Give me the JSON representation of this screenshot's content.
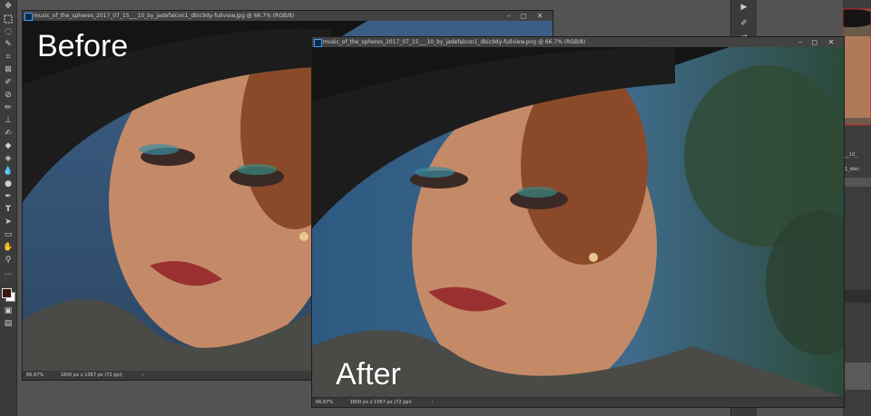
{
  "before_window": {
    "title": "music_of_the_spheres_2017_07_15___10_by_jadefalcon1_dbic9dy-fullview.jpg @ 66.7% (RGB/8)",
    "zoom": "66.67%",
    "dimensions": "1600 px x 1067 px (72 ppi)",
    "overlay_label": "Before"
  },
  "after_window": {
    "title": "music_of_the_spheres_2017_07_15___10_by_jadefalcon1_dbic9dy-fullview.png @ 66.7% (RGB/8)",
    "zoom": "66.67%",
    "dimensions": "1600 px x 1067 px (72 ppi)",
    "overlay_label": "After"
  },
  "window_controls": {
    "minimize": "–",
    "restore": "◻",
    "close": "✕"
  },
  "status_arrow": "›",
  "toolbar": {
    "tools": [
      "move-tool",
      "marquee-tool",
      "lasso-tool",
      "quick-select-tool",
      "crop-tool",
      "frame-tool",
      "eyedropper-tool",
      "healing-brush-tool",
      "brush-tool",
      "clone-stamp-tool",
      "history-brush-tool",
      "eraser-tool",
      "paint-bucket-tool",
      "blur-tool",
      "dodge-tool",
      "pen-tool",
      "type-tool",
      "path-select-tool",
      "shape-tool",
      "hand-tool",
      "zoom-tool",
      "more-tools-icon"
    ],
    "foreground_color": "#3b1611",
    "background_color": "#ffffff"
  },
  "right_panel": {
    "text1": "__10_",
    "text2": "1_dbic"
  }
}
